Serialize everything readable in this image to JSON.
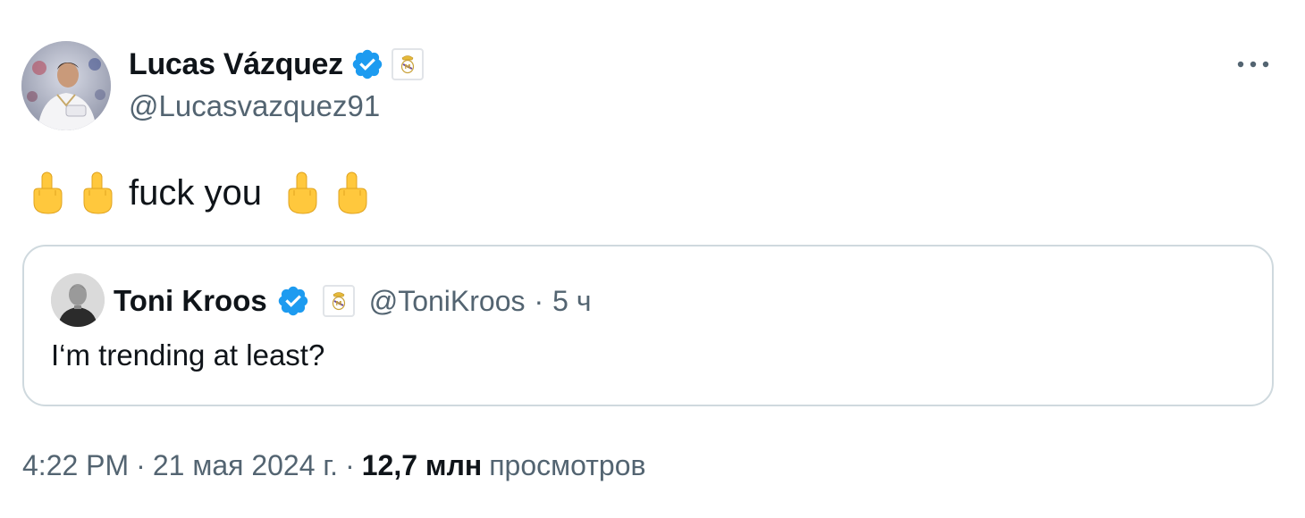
{
  "author": {
    "name": "Lucas Vázquez",
    "handle": "@Lucasvazquez91"
  },
  "more_icon": "more-horizontal-icon",
  "tweet": {
    "text": "fuck you",
    "leading_emoji": [
      "middle-finger-emoji",
      "middle-finger-emoji"
    ],
    "trailing_emoji": [
      "middle-finger-emoji",
      "middle-finger-emoji"
    ]
  },
  "quote": {
    "name": "Toni Kroos",
    "handle": "@ToniKroos",
    "separator": "·",
    "time": "5 ч",
    "text": "I‘m trending at least?"
  },
  "footer": {
    "time": "4:22 PM",
    "separator": "·",
    "date": "21 мая 2024 г.",
    "separator2": "·",
    "views_count": "12,7 млн",
    "views_label": "просмотров"
  },
  "colors": {
    "verified_blue": "#1d9bf0",
    "secondary_text": "#536471",
    "primary_text": "#0f1419",
    "border": "#cfd9de"
  }
}
